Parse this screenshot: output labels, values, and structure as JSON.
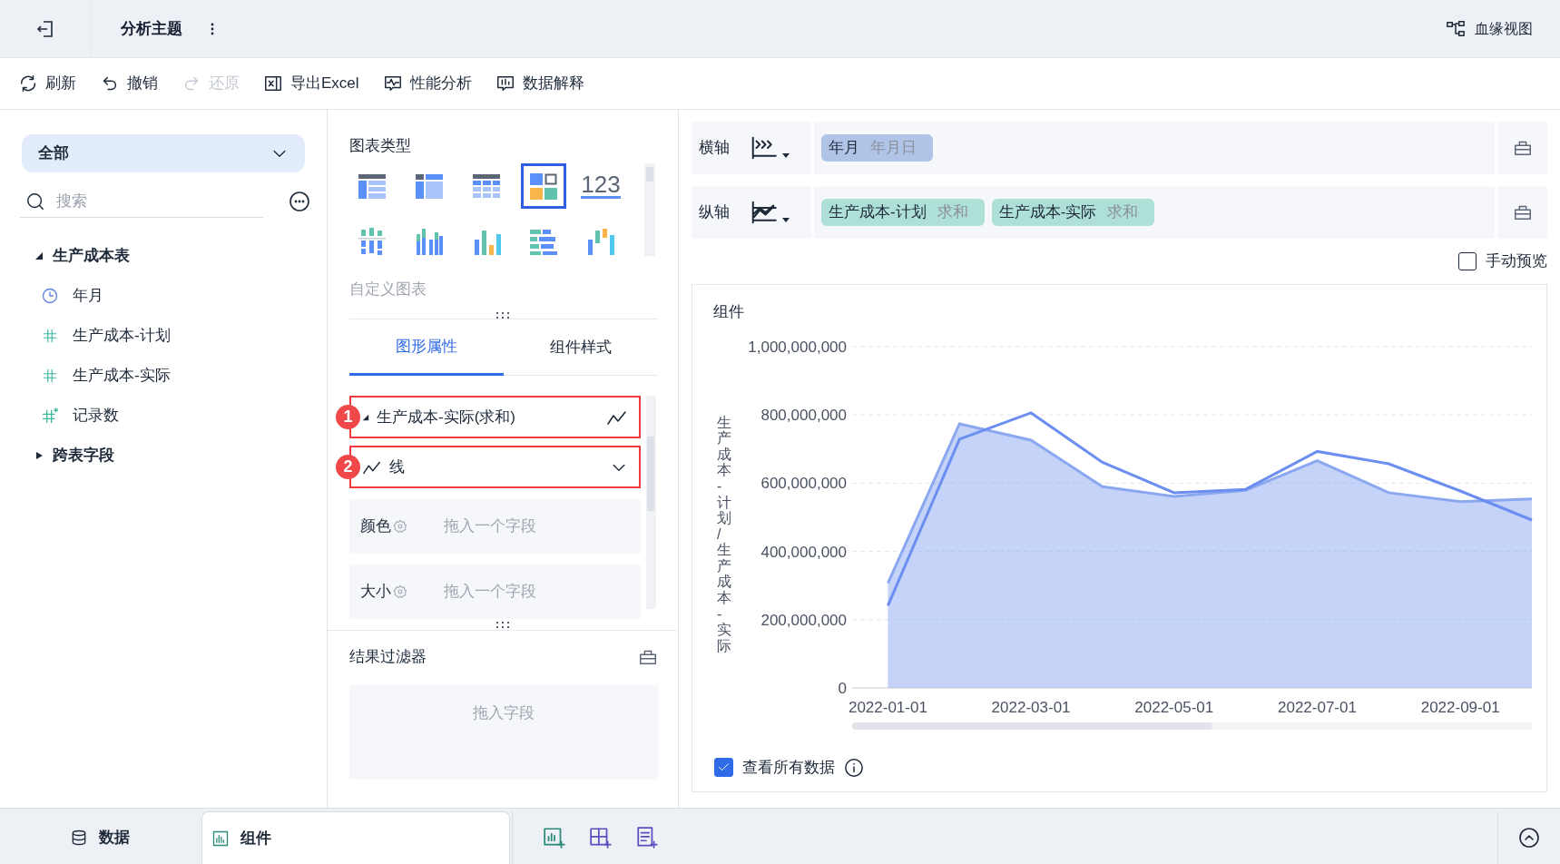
{
  "header": {
    "title": "分析主题",
    "lineage_button": "血缘视图"
  },
  "toolbar": [
    {
      "label": "刷新",
      "kind": "refresh",
      "disabled": false
    },
    {
      "label": "撤销",
      "kind": "undo",
      "disabled": false
    },
    {
      "label": "还原",
      "kind": "redo",
      "disabled": true
    },
    {
      "label": "导出Excel",
      "kind": "excel",
      "disabled": false
    },
    {
      "label": "性能分析",
      "kind": "performance",
      "disabled": false
    },
    {
      "label": "数据解释",
      "kind": "explain",
      "disabled": false
    }
  ],
  "sidebar": {
    "scope": "全部",
    "search": {
      "placeholder": "搜索"
    },
    "tree": [
      {
        "label": "生产成本表",
        "expanded": true,
        "children": [
          {
            "label": "年月",
            "kind": "date"
          },
          {
            "label": "生产成本-计划",
            "kind": "number"
          },
          {
            "label": "生产成本-实际",
            "kind": "number"
          },
          {
            "label": "记录数",
            "kind": "count"
          }
        ]
      },
      {
        "label": "跨表字段",
        "expanded": false
      }
    ]
  },
  "chart_panel": {
    "title": "图表类型",
    "chart_types": [
      {
        "kind": "group-table",
        "selected": false
      },
      {
        "kind": "cross-table",
        "selected": false
      },
      {
        "kind": "detail-table",
        "selected": false
      },
      {
        "kind": "mosaic",
        "selected": true
      },
      {
        "kind": "number",
        "label": "123",
        "selected": false
      },
      {
        "kind": "stacked-bar",
        "selected": false
      },
      {
        "kind": "grouped-bar",
        "selected": false
      },
      {
        "kind": "color-bar",
        "selected": false
      },
      {
        "kind": "horizontal-bar",
        "selected": false
      },
      {
        "kind": "range-bar",
        "selected": false
      }
    ],
    "custom_label": "自定义图表",
    "tabs": [
      {
        "label": "图形属性",
        "selected": true
      },
      {
        "label": "组件样式",
        "selected": false
      }
    ],
    "series_rows": [
      {
        "kind": "series",
        "label": "生产成本-实际(求和)",
        "badge": "1",
        "highlighted": true
      },
      {
        "kind": "mark-type",
        "label": "线",
        "badge": "2",
        "highlighted": true
      }
    ],
    "properties": [
      {
        "label": "颜色",
        "hint": "拖入一个字段"
      },
      {
        "label": "大小",
        "hint": "拖入一个字段"
      }
    ],
    "filter": {
      "title": "结果过滤器",
      "hint": "拖入字段"
    }
  },
  "axes": [
    {
      "label": "横轴",
      "kind": "horizontal",
      "fields": [
        {
          "name": "年月",
          "aggregation": "年月日",
          "kind": "dimension"
        }
      ]
    },
    {
      "label": "纵轴",
      "kind": "vertical",
      "fields": [
        {
          "name": "生产成本-计划",
          "aggregation": "求和",
          "kind": "measure"
        },
        {
          "name": "生产成本-实际",
          "aggregation": "求和",
          "kind": "measure"
        }
      ]
    }
  ],
  "manual_preview": {
    "label": "手动预览",
    "checked": false
  },
  "widget": {
    "title": "组件",
    "chart_data": {
      "type": "area",
      "ylabel": "生产成本-计划/生产成本-实际",
      "categories": [
        "2022-01-01",
        null,
        "2022-03-01",
        null,
        "2022-05-01",
        null,
        "2022-07-01",
        null,
        "2022-09-01",
        null
      ],
      "series": [
        {
          "type": "area",
          "color": "#8aa7f0",
          "values": [
            307000000,
            774000000,
            726000000,
            590000000,
            561000000,
            579000000,
            666000000,
            572000000,
            546000000,
            554000000
          ]
        },
        {
          "type": "line",
          "color": "#6b8ef0",
          "values": [
            241000000,
            729000000,
            806000000,
            661000000,
            572000000,
            582000000,
            693000000,
            657000000,
            577000000,
            492000000
          ]
        }
      ],
      "ylim": [
        0,
        1000000000
      ],
      "grid": true,
      "yticks": [
        {
          "value": 0,
          "label": "0"
        },
        {
          "value": 200000000,
          "label": "200,000,000"
        },
        {
          "value": 400000000,
          "label": "400,000,000"
        },
        {
          "value": 600000000,
          "label": "600,000,000"
        },
        {
          "value": 800000000,
          "label": "800,000,000"
        },
        {
          "value": 1000000000,
          "label": "1,000,000,000"
        }
      ]
    },
    "show_all": {
      "label": "查看所有数据",
      "checked": true
    }
  },
  "bottom_tabs": [
    {
      "label": "数据",
      "kind": "data",
      "selected": false
    },
    {
      "label": "组件",
      "kind": "widget",
      "selected": true
    }
  ]
}
